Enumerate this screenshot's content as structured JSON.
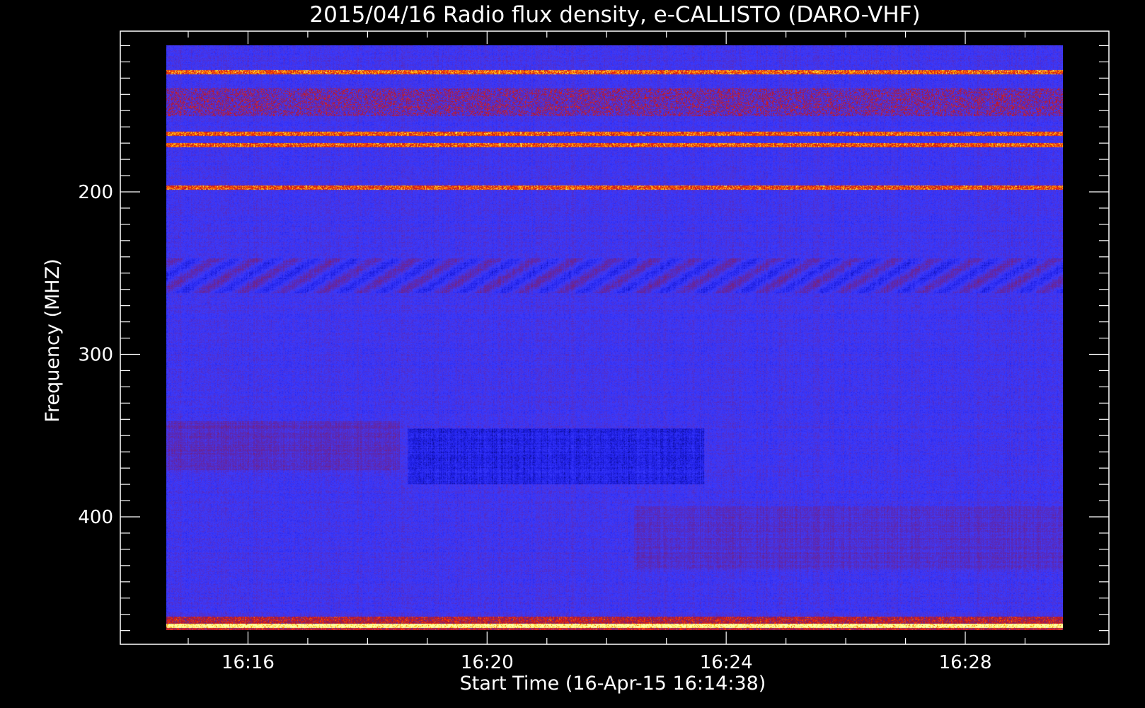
{
  "chart_data": {
    "type": "heatmap",
    "title": "2015/04/16  Radio flux density, e-CALLISTO (DARO-VHF)",
    "xlabel": "Start Time (16-Apr-15 16:14:38)",
    "ylabel": "Frequency (MHZ)",
    "x_ticks": [
      "16:16",
      "16:20",
      "16:24",
      "16:28"
    ],
    "y_ticks": [
      "200",
      "300",
      "400"
    ],
    "x_range": [
      "16:14:38",
      "16:29:38"
    ],
    "y_range_mhz": [
      470,
      105
    ],
    "y_axis_direction": "frequency increasing downward",
    "colormap": [
      "#000050",
      "#1e1ee6",
      "#3c3cff",
      "#5a28b4",
      "#8c1e50",
      "#c8141e",
      "#ff3c00",
      "#ffc800",
      "#ffffa0"
    ],
    "features": [
      {
        "name": "narrowband interference",
        "frequency_mhz": 164
      },
      {
        "name": "narrowband interference",
        "frequency_mhz": 171
      },
      {
        "name": "narrowband interference",
        "frequency_mhz": 197
      },
      {
        "name": "interference band",
        "frequency_mhz": 126
      },
      {
        "name": "interference band",
        "frequency_mhz": 467
      }
    ]
  },
  "colors": {
    "background": "#000000",
    "axis": "#ffffff"
  }
}
